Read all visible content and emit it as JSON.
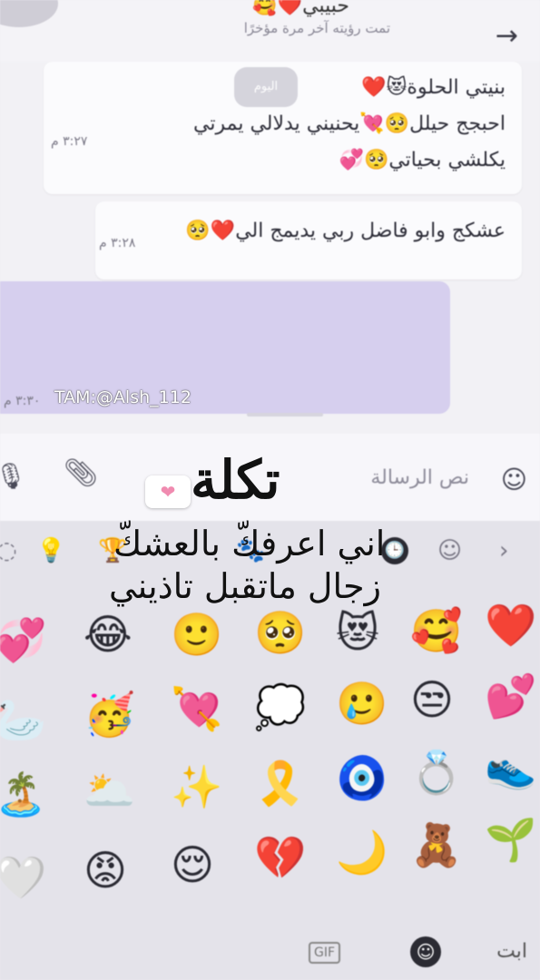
{
  "header": {
    "contact_name": "حبيبي❤️🥰",
    "last_seen": "تمت رؤيته آخر مرة مؤخرًا",
    "back_icon": "arrow-right-icon"
  },
  "chat": {
    "date_pill": "اليوم",
    "message1": {
      "lines": [
        "بنيتي الحلوة😻❤️",
        "احبجج حيلل🥺💘يحنيني يدلالي يمرتي",
        "يكلشي بحياتي🥺💞"
      ],
      "time": "٣:٢٧ م"
    },
    "message2": {
      "text": "عشكج وابو فاضل ربي يديمج الي❤️🥺",
      "time": "٣:٢٨ م"
    },
    "outgoing": {
      "time": "٣:٣٠ م"
    }
  },
  "input": {
    "placeholder": "نص الرسالة",
    "mic_icon": "mic-icon",
    "attach_icon": "paperclip-icon",
    "emoji_icon": "smile-icon"
  },
  "keyboard": {
    "categories": [
      "◌",
      "💡",
      "🏆",
      "🐾",
      "🕒",
      "☺",
      "›"
    ],
    "rows": [
      [
        "💞",
        "😂",
        "🙂",
        "🥺",
        "😻",
        "🥰",
        "❤️"
      ],
      [
        "🦢",
        "🥳",
        "💘",
        "💭",
        "🥲",
        "😒",
        "💕"
      ],
      [
        "🏝️",
        "🌥️",
        "✨",
        "🎗️",
        "🧿",
        "💍",
        "👟"
      ],
      [
        "🤍",
        "😡",
        "😌",
        "💔",
        "🌙",
        "🧸",
        "🌱"
      ]
    ],
    "bottom": {
      "abc_label": "ابت",
      "gif_label": "GIF"
    }
  },
  "overlay": {
    "watermark": "TAM:@Alsh_112",
    "title": "تكلة",
    "line1": "اني اعرفكّ بالعشكّ",
    "line2": "زجال ماتقبل تاذيني",
    "heart": "❤"
  }
}
